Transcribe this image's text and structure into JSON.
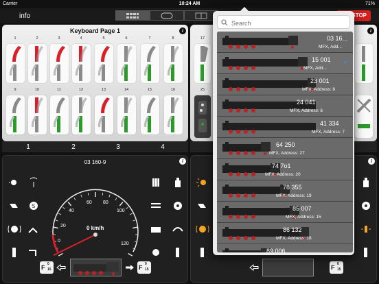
{
  "status": {
    "carrier": "Carrier",
    "time": "10:24 AM",
    "battery": "71%"
  },
  "topbar": {
    "info": "info",
    "stop": "STOP"
  },
  "keyboard": {
    "title": "Keyboard Page 1",
    "row1_numbers": [
      "1",
      "2",
      "3",
      "4",
      "5",
      "6",
      "7",
      "8"
    ],
    "row2_numbers": [
      "9",
      "10",
      "11",
      "12",
      "13",
      "14",
      "15",
      "16"
    ],
    "pages": [
      "1",
      "2",
      "3",
      "4"
    ],
    "right_numbers": [
      "17",
      "25"
    ]
  },
  "control": {
    "loco_title": "03 160-9",
    "speed_unit": "0 km/h",
    "ticks": [
      "0",
      "20",
      "40",
      "60",
      "80",
      "100",
      "120"
    ],
    "function_key": {
      "f": "F",
      "top": "0",
      "bottom": "15"
    }
  },
  "search": {
    "placeholder": "Search"
  },
  "locomotives": [
    {
      "name": "03 16...",
      "address": "MFX, Add...",
      "selected": false
    },
    {
      "name": "15 001",
      "address": "MFX, Add...",
      "selected": true
    },
    {
      "name": "23 001",
      "address": "MFX, Address: 8",
      "selected": false
    },
    {
      "name": "24 041",
      "address": "MFX, Address: 6",
      "selected": false
    },
    {
      "name": "41 334",
      "address": "MFX, Address: 7",
      "selected": false
    },
    {
      "name": "64 250",
      "address": "MFX, Address: 27",
      "selected": false
    },
    {
      "name": "74 7o1",
      "address": "MFX, Address: 20",
      "selected": false
    },
    {
      "name": "78 355",
      "address": "MFX, Address: 19",
      "selected": false
    },
    {
      "name": "85 007",
      "address": "MFX, Address: 15",
      "selected": false
    },
    {
      "name": "86 132",
      "address": "MFX, Address: 18",
      "selected": false
    },
    {
      "name": "89 006",
      "address": "",
      "selected": false
    }
  ],
  "colors": {
    "turnout_red": "#d8202a",
    "turnout_green": "#2a9a2a",
    "stop": "#d51e1e",
    "accent": "#f5a623"
  }
}
